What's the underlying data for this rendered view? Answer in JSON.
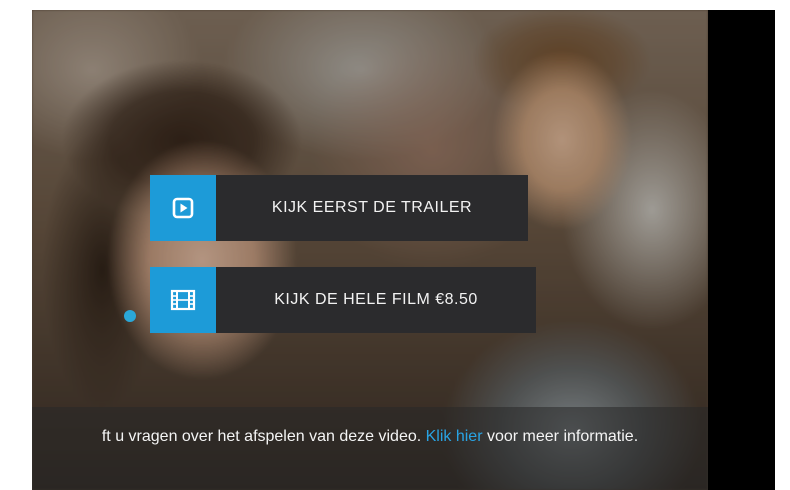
{
  "buttons": {
    "trailer": {
      "label": "KIJK EERST DE TRAILER",
      "icon": "play-icon"
    },
    "film": {
      "label": "KIJK DE HELE FILM €8.50",
      "icon": "film-icon"
    }
  },
  "info": {
    "text_before": "ft u vragen over het afspelen van deze video. ",
    "link_label": "Klik hier",
    "text_after": " voor meer informatie."
  },
  "colors": {
    "accent": "#1d9bd8",
    "link": "#29a3e3",
    "button_bg": "#2b2b2d"
  }
}
